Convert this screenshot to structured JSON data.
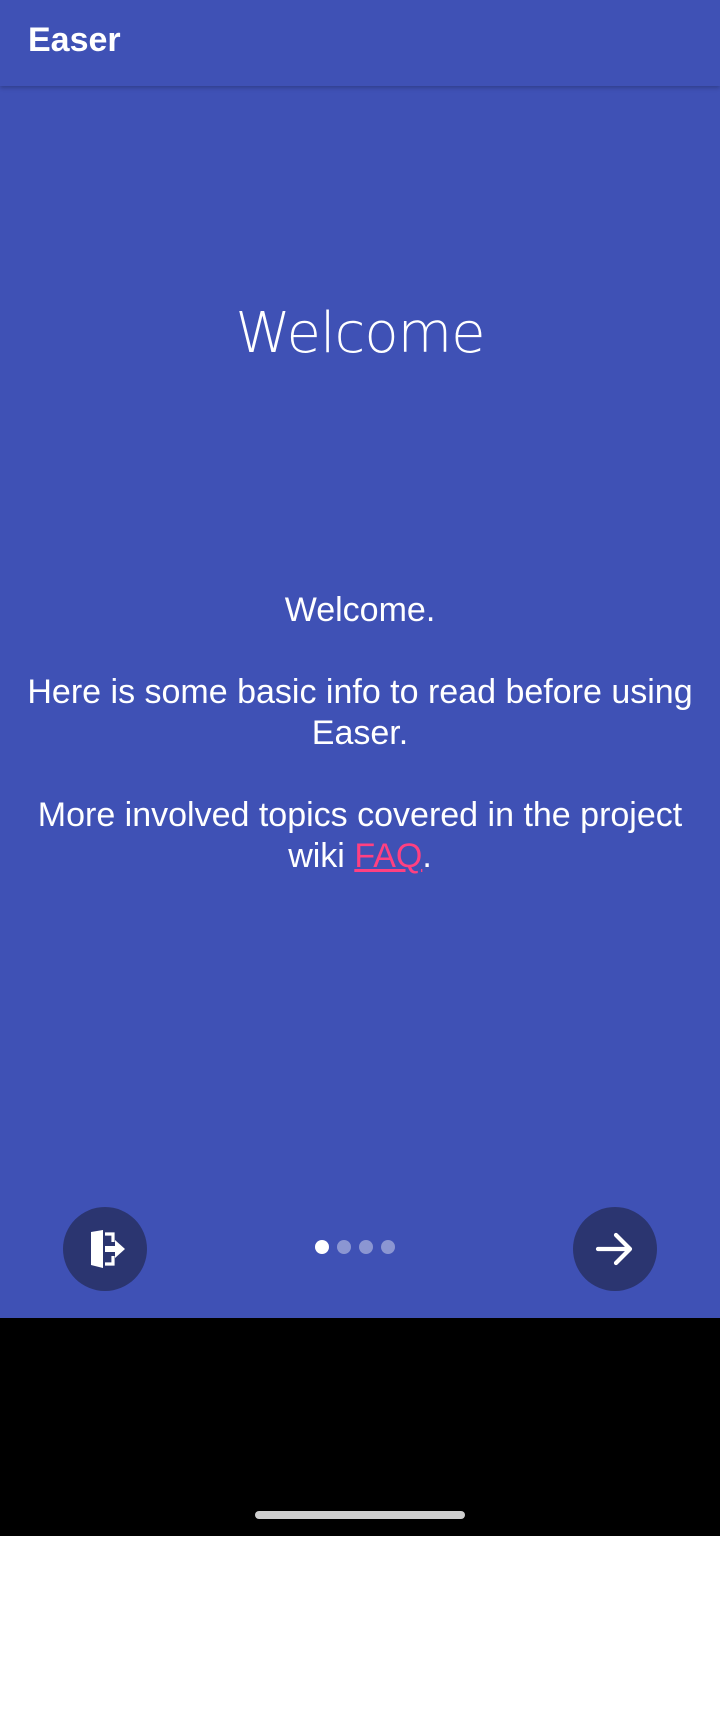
{
  "toolbar": {
    "title": "Easer"
  },
  "intro": {
    "title": "Welcome",
    "paragraph1": "Welcome.",
    "paragraph2": "Here is some basic info to read before using Easer.",
    "paragraph3_prefix": "More involved topics covered in the project wiki ",
    "faq_link": "FAQ",
    "paragraph3_suffix": "."
  },
  "pager": {
    "total_pages": 4,
    "current_page": 1
  },
  "icons": {
    "skip": "exit-door-icon",
    "next": "arrow-right-icon"
  },
  "colors": {
    "primary": "#3f51b5",
    "button": "#2b3570",
    "accent": "#ff4081"
  }
}
